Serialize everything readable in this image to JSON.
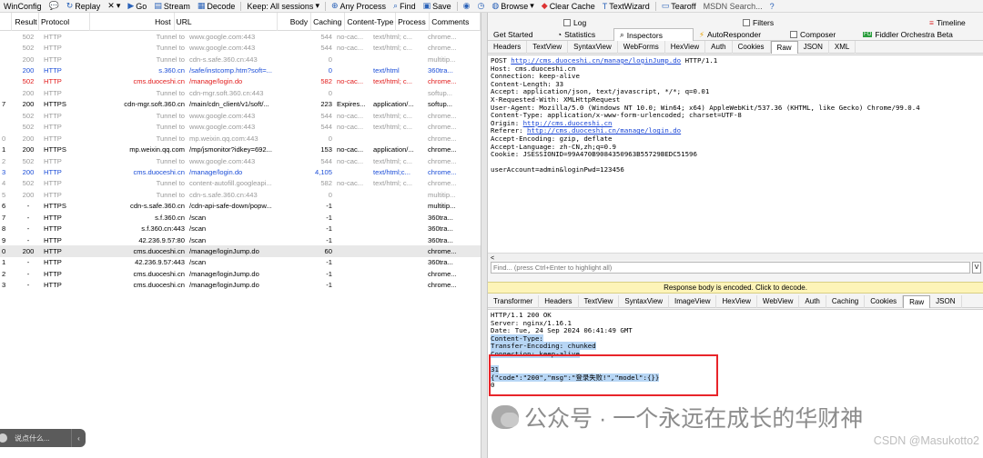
{
  "toolbar": {
    "winconfig": "WinConfig",
    "replay": "Replay",
    "remove": "✕",
    "go": "Go",
    "stream": "Stream",
    "decode": "Decode",
    "keep": "Keep: All sessions",
    "any_process": "Any Process",
    "find": "Find",
    "save": "Save",
    "browse": "Browse",
    "clear_cache": "Clear Cache",
    "textwizard": "TextWizard",
    "tearoff": "Tearoff",
    "msdn": "MSDN Search..."
  },
  "sessions": {
    "columns": [
      "",
      "Result",
      "Protocol",
      "Host",
      "URL",
      "Body",
      "Caching",
      "Content-Type",
      "Process",
      "Comments"
    ],
    "rows": [
      {
        "num": "",
        "result": "502",
        "protocol": "HTTP",
        "host": "Tunnel to",
        "url": "www.google.com:443",
        "body": "544",
        "caching": "no-cac...",
        "ctype": "text/html; c...",
        "process": "chrome...",
        "style": "gray"
      },
      {
        "num": "",
        "result": "502",
        "protocol": "HTTP",
        "host": "Tunnel to",
        "url": "www.google.com:443",
        "body": "544",
        "caching": "no-cac...",
        "ctype": "text/html; c...",
        "process": "chrome...",
        "style": "gray"
      },
      {
        "num": "",
        "result": "200",
        "protocol": "HTTP",
        "host": "Tunnel to",
        "url": "cdn-s.safe.360.cn:443",
        "body": "0",
        "caching": "",
        "ctype": "",
        "process": "multitip...",
        "style": "gray"
      },
      {
        "num": "",
        "result": "200",
        "protocol": "HTTP",
        "host": "s.360.cn",
        "url": "/safe/instcomp.htm?soft=...",
        "body": "0",
        "caching": "",
        "ctype": "text/html",
        "process": "360tra...",
        "style": "blue"
      },
      {
        "num": "",
        "result": "502",
        "protocol": "HTTP",
        "host": "cms.duoceshi.cn",
        "url": "/manage/login.do",
        "body": "582",
        "caching": "no-cac...",
        "ctype": "text/html; c...",
        "process": "chrome...",
        "style": "red"
      },
      {
        "num": "",
        "result": "200",
        "protocol": "HTTP",
        "host": "Tunnel to",
        "url": "cdn-mgr.soft.360.cn:443",
        "body": "0",
        "caching": "",
        "ctype": "",
        "process": "softup...",
        "style": "gray"
      },
      {
        "num": "7",
        "result": "200",
        "protocol": "HTTPS",
        "host": "cdn-mgr.soft.360.cn",
        "url": "/main/cdn_client/v1/soft/...",
        "body": "223",
        "caching": "Expires...",
        "ctype": "application/...",
        "process": "softup...",
        "style": ""
      },
      {
        "num": "",
        "result": "502",
        "protocol": "HTTP",
        "host": "Tunnel to",
        "url": "www.google.com:443",
        "body": "544",
        "caching": "no-cac...",
        "ctype": "text/html; c...",
        "process": "chrome...",
        "style": "gray"
      },
      {
        "num": "",
        "result": "502",
        "protocol": "HTTP",
        "host": "Tunnel to",
        "url": "www.google.com:443",
        "body": "544",
        "caching": "no-cac...",
        "ctype": "text/html; c...",
        "process": "chrome...",
        "style": "gray"
      },
      {
        "num": "0",
        "result": "200",
        "protocol": "HTTP",
        "host": "Tunnel to",
        "url": "mp.weixin.qq.com:443",
        "body": "0",
        "caching": "",
        "ctype": "",
        "process": "chrome...",
        "style": "gray"
      },
      {
        "num": "1",
        "result": "200",
        "protocol": "HTTPS",
        "host": "mp.weixin.qq.com",
        "url": "/mp/jsmonitor?idkey=692...",
        "body": "153",
        "caching": "no-cac...",
        "ctype": "application/...",
        "process": "chrome...",
        "style": ""
      },
      {
        "num": "2",
        "result": "502",
        "protocol": "HTTP",
        "host": "Tunnel to",
        "url": "www.google.com:443",
        "body": "544",
        "caching": "no-cac...",
        "ctype": "text/html; c...",
        "process": "chrome...",
        "style": "gray"
      },
      {
        "num": "3",
        "result": "200",
        "protocol": "HTTP",
        "host": "cms.duoceshi.cn",
        "url": "/manage/login.do",
        "body": "4,105",
        "caching": "",
        "ctype": "text/html;c...",
        "process": "chrome...",
        "style": "blue"
      },
      {
        "num": "4",
        "result": "502",
        "protocol": "HTTP",
        "host": "Tunnel to",
        "url": "content-autofill.googleapi...",
        "body": "582",
        "caching": "no-cac...",
        "ctype": "text/html; c...",
        "process": "chrome...",
        "style": "gray"
      },
      {
        "num": "5",
        "result": "200",
        "protocol": "HTTP",
        "host": "Tunnel to",
        "url": "cdn-s.safe.360.cn:443",
        "body": "0",
        "caching": "",
        "ctype": "",
        "process": "multitip...",
        "style": "gray"
      },
      {
        "num": "6",
        "result": "-",
        "protocol": "HTTPS",
        "host": "cdn-s.safe.360.cn",
        "url": "/cdn-api-safe-down/popw...",
        "body": "-1",
        "caching": "",
        "ctype": "",
        "process": "multitip...",
        "style": ""
      },
      {
        "num": "7",
        "result": "-",
        "protocol": "HTTP",
        "host": "s.f.360.cn",
        "url": "/scan",
        "body": "-1",
        "caching": "",
        "ctype": "",
        "process": "360tra...",
        "style": ""
      },
      {
        "num": "8",
        "result": "-",
        "protocol": "HTTP",
        "host": "s.f.360.cn:443",
        "url": "/scan",
        "body": "-1",
        "caching": "",
        "ctype": "",
        "process": "360tra...",
        "style": ""
      },
      {
        "num": "9",
        "result": "-",
        "protocol": "HTTP",
        "host": "42.236.9.57:80",
        "url": "/scan",
        "body": "-1",
        "caching": "",
        "ctype": "",
        "process": "360tra...",
        "style": ""
      },
      {
        "num": "0",
        "result": "200",
        "protocol": "HTTP",
        "host": "cms.duoceshi.cn",
        "url": "/manage/loginJump.do",
        "body": "60",
        "caching": "",
        "ctype": "",
        "process": "chrome...",
        "style": "sel"
      },
      {
        "num": "1",
        "result": "-",
        "protocol": "HTTP",
        "host": "42.236.9.57:443",
        "url": "/scan",
        "body": "-1",
        "caching": "",
        "ctype": "",
        "process": "360tra...",
        "style": ""
      },
      {
        "num": "2",
        "result": "-",
        "protocol": "HTTP",
        "host": "cms.duoceshi.cn",
        "url": "/manage/loginJump.do",
        "body": "-1",
        "caching": "",
        "ctype": "",
        "process": "chrome...",
        "style": ""
      },
      {
        "num": "3",
        "result": "-",
        "protocol": "HTTP",
        "host": "cms.duoceshi.cn",
        "url": "/manage/loginJump.do",
        "body": "-1",
        "caching": "",
        "ctype": "",
        "process": "chrome...",
        "style": ""
      }
    ]
  },
  "bubble": {
    "text": "说点什么..."
  },
  "inspector": {
    "top_tabs": {
      "log": "Log",
      "filters": "Filters",
      "timeline": "Timeline"
    },
    "main_tabs": [
      "Get Started",
      "Statistics",
      "Inspectors",
      "AutoResponder",
      "Composer",
      "Fiddler Orchestra Beta"
    ],
    "request_tabs": [
      "Headers",
      "TextView",
      "SyntaxView",
      "WebForms",
      "HexView",
      "Auth",
      "Cookies",
      "Raw",
      "JSON",
      "XML"
    ],
    "request_raw": [
      {
        "pre": "POST ",
        "link": "http://cms.duoceshi.cn/manage/loginJump.do",
        "post": " HTTP/1.1"
      },
      {
        "pre": "Host: cms.duoceshi.cn",
        "link": "",
        "post": ""
      },
      {
        "pre": "Connection: keep-alive",
        "link": "",
        "post": ""
      },
      {
        "pre": "Content-Length: 33",
        "link": "",
        "post": ""
      },
      {
        "pre": "Accept: application/json, text/javascript, */*; q=0.01",
        "link": "",
        "post": ""
      },
      {
        "pre": "X-Requested-With: XMLHttpRequest",
        "link": "",
        "post": ""
      },
      {
        "pre": "User-Agent: Mozilla/5.0 (Windows NT 10.0; Win64; x64) AppleWebKit/537.36 (KHTML, like Gecko) Chrome/99.0.4",
        "link": "",
        "post": ""
      },
      {
        "pre": "Content-Type: application/x-www-form-urlencoded; charset=UTF-8",
        "link": "",
        "post": ""
      },
      {
        "pre": "Origin: ",
        "link": "http://cms.duoceshi.cn",
        "post": ""
      },
      {
        "pre": "Referer: ",
        "link": "http://cms.duoceshi.cn/manage/login.do",
        "post": ""
      },
      {
        "pre": "Accept-Encoding: gzip, deflate",
        "link": "",
        "post": ""
      },
      {
        "pre": "Accept-Language: zh-CN,zh;q=0.9",
        "link": "",
        "post": ""
      },
      {
        "pre": "Cookie: JSESSIONID=99A470B9084350963B55729BEDC51596",
        "link": "",
        "post": ""
      },
      {
        "pre": "",
        "link": "",
        "post": ""
      },
      {
        "pre": "userAccount=admin&loginPwd=123456",
        "link": "",
        "post": ""
      }
    ],
    "find_placeholder": "Find... (press Ctrl+Enter to highlight all)",
    "view_button": "V",
    "encoded_notice": "Response body is encoded. Click to decode.",
    "response_tabs": [
      "Transformer",
      "Headers",
      "TextView",
      "SyntaxView",
      "ImageView",
      "HexView",
      "WebView",
      "Auth",
      "Caching",
      "Cookies",
      "Raw",
      "JSON"
    ],
    "response_raw": [
      {
        "text": "HTTP/1.1 200 OK",
        "hl": false
      },
      {
        "text": "Server: nginx/1.16.1",
        "hl": false
      },
      {
        "text": "Date: Tue, 24 Sep 2024 06:41:49 GMT",
        "hl": false
      },
      {
        "text": "Content-Type:",
        "hl": true
      },
      {
        "text": "Transfer-Encoding: chunked",
        "hl": true
      },
      {
        "text": "Connection: keep-alive",
        "hl": true
      },
      {
        "text": "",
        "hl": false
      },
      {
        "text": "31",
        "hl": true
      },
      {
        "text": "{\"code\":\"200\",\"msg\":\"登录失败!\",\"model\":{}}",
        "hl": true
      },
      {
        "text": "0",
        "hl": false
      }
    ]
  },
  "watermark": {
    "text": "公众号 · 一个永远在成长的华财神",
    "csdn": "CSDN @Masukotto2"
  }
}
